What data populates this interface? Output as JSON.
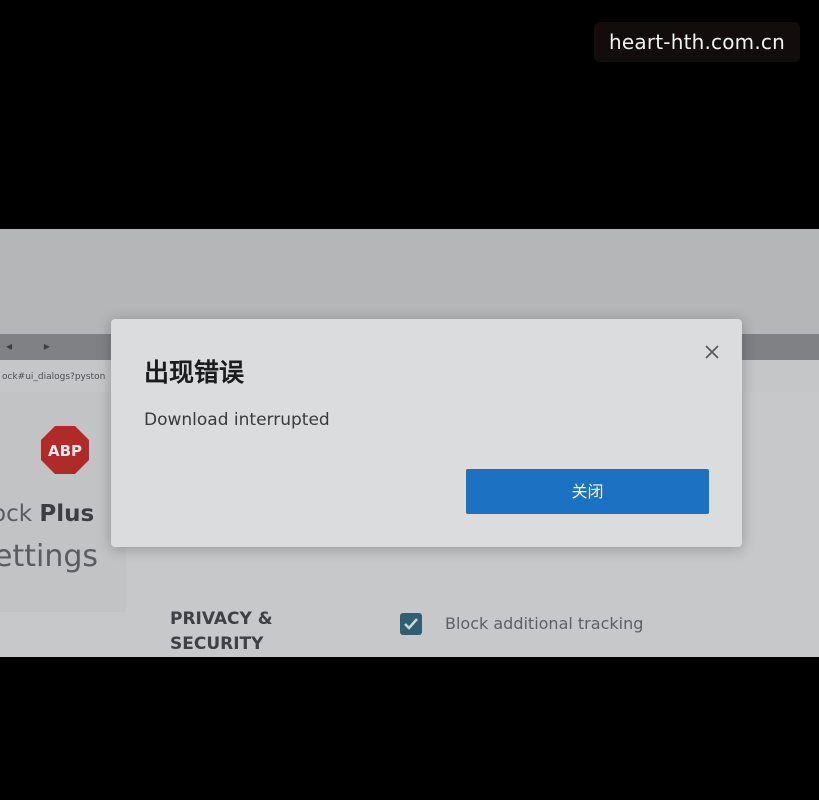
{
  "watermark": {
    "text": "heart-hth.com.cn"
  },
  "background_page": {
    "url_fragment": "ock#ui_dialogs?pyston",
    "logo_text": "ABP",
    "brand_partial": "ock ",
    "brand_bold": "Plus",
    "settings_partial": "ettings",
    "section_heading_line1": "PRIVACY &",
    "section_heading_line2": "SECURITY",
    "checkbox_label": "Block additional tracking",
    "checkbox_checked": true,
    "logo_color": "#b02a2a"
  },
  "dialog": {
    "title": "出现错误",
    "message": "Download interrupted",
    "button_label": "关闭",
    "close_icon": "close-icon",
    "button_color": "#1b72c2"
  }
}
